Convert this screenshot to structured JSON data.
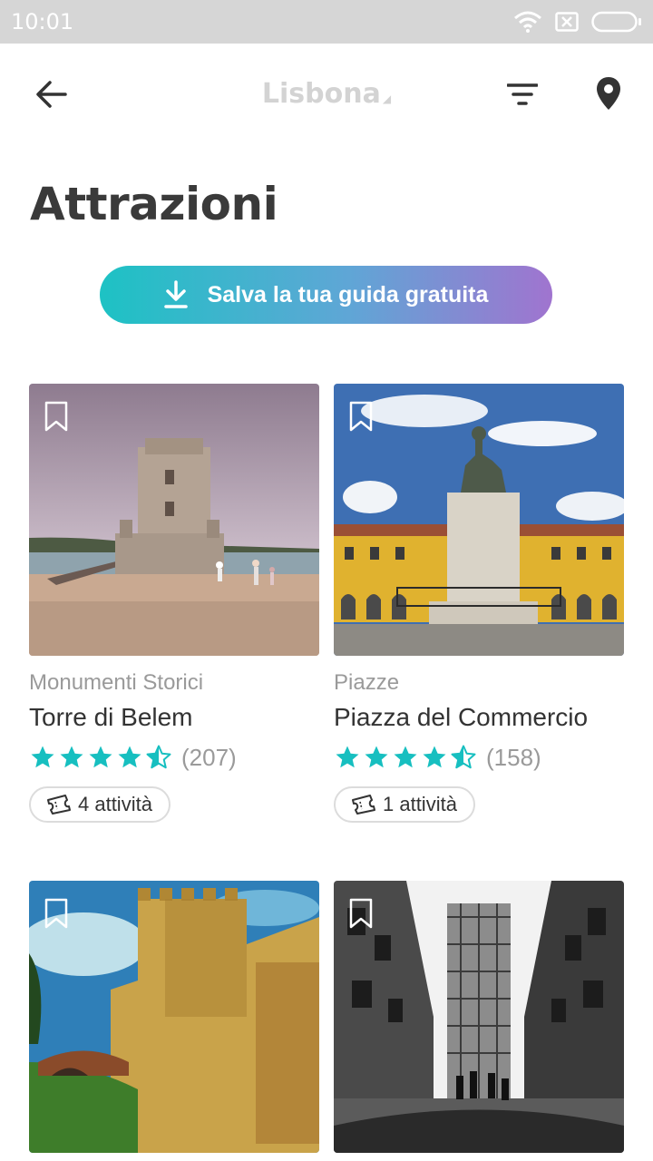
{
  "status_bar": {
    "time": "10:01"
  },
  "header": {
    "city": "Lisbona"
  },
  "page": {
    "title": "Attrazioni"
  },
  "save_guide": {
    "label": "Salva la tua guida gratuita"
  },
  "colors": {
    "accent": "#1dc2c4",
    "gradient_start": "#1dc2c4",
    "gradient_end": "#a074cf",
    "star": "#17bfc0"
  },
  "attractions": [
    {
      "category": "Monumenti Storici",
      "name": "Torre di Belem",
      "rating": 4.5,
      "review_count": "(207)",
      "activities": "4 attività",
      "image": "tower-photo"
    },
    {
      "category": "Piazze",
      "name": "Piazza del Commercio",
      "rating": 4.5,
      "review_count": "(158)",
      "activities": "1 attività",
      "image": "square-statue-photo"
    },
    {
      "category": "",
      "name": "",
      "image": "castle-photo"
    },
    {
      "category": "",
      "name": "",
      "image": "elevator-photo"
    }
  ]
}
